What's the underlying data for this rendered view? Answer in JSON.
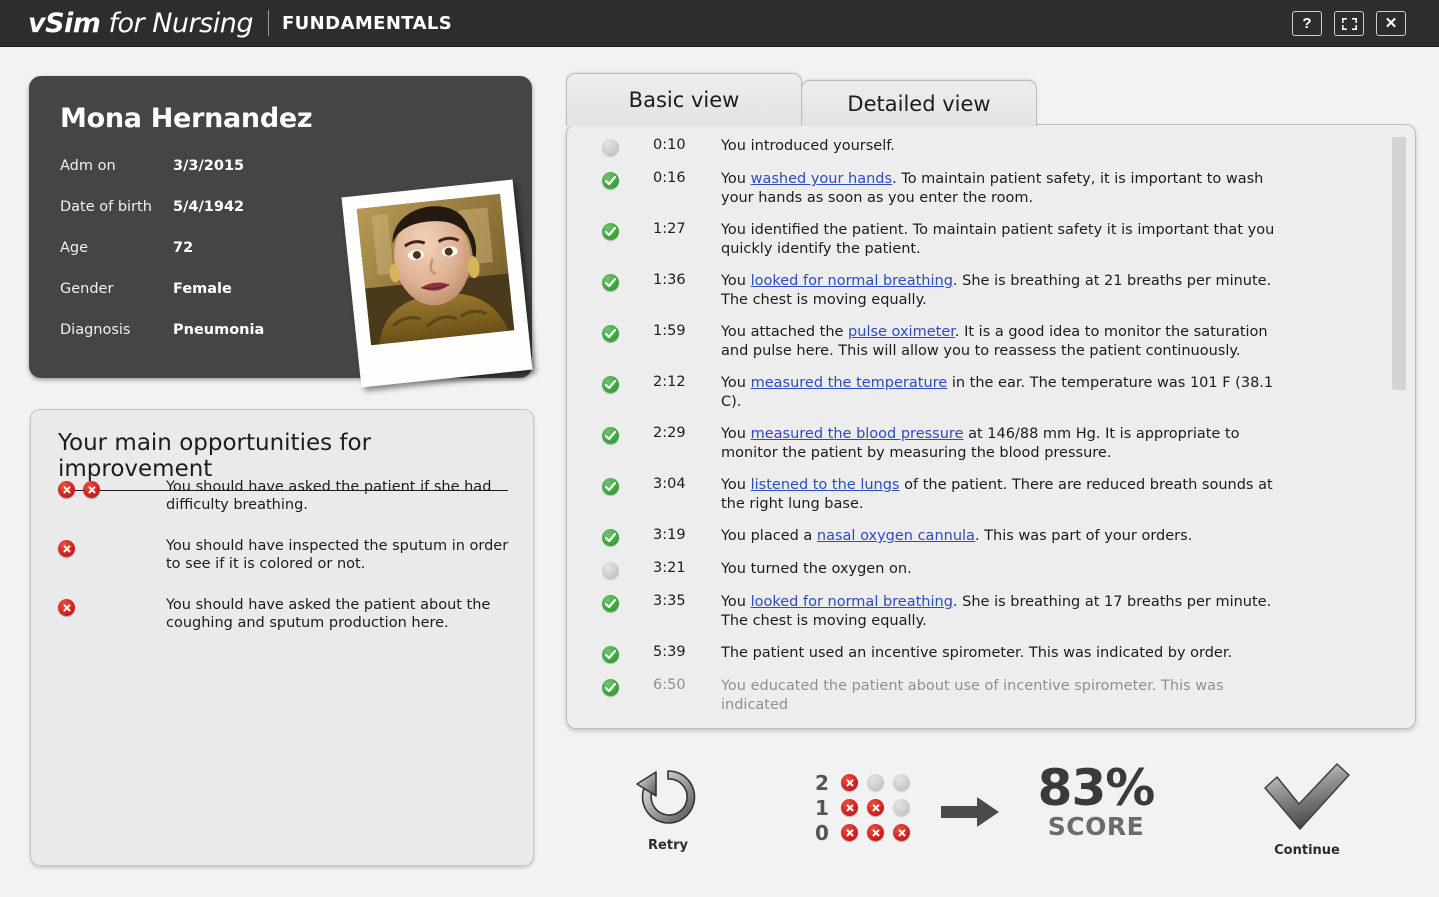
{
  "app": {
    "logo_primary": "vSim for Nursing",
    "logo_primary_bold": "vSim",
    "logo_primary_rest": " for Nursing",
    "logo_secondary": "FUNDAMENTALS"
  },
  "window_controls": {
    "help_label": "?",
    "fullscreen_label": "fullscreen-icon",
    "close_label": "✕"
  },
  "patient": {
    "name": "Mona Hernandez",
    "fields": [
      {
        "label": "Adm on",
        "value": "3/3/2015"
      },
      {
        "label": "Date of birth",
        "value": "5/4/1942"
      },
      {
        "label": "Age",
        "value": "72"
      },
      {
        "label": "Gender",
        "value": "Female"
      },
      {
        "label": "Diagnosis",
        "value": "Pneumonia"
      }
    ]
  },
  "improvements": {
    "title": "Your main opportunities for improvement",
    "items": [
      {
        "icons": 2,
        "text": "You should have asked the patient if she had difficulty breathing."
      },
      {
        "icons": 1,
        "text": "You should have inspected the sputum in order to see if it is colored or not."
      },
      {
        "icons": 1,
        "text": "You should have asked the patient about the coughing and sputum production here."
      }
    ]
  },
  "tabs": [
    {
      "label": "Basic view",
      "active": true
    },
    {
      "label": "Detailed view",
      "active": false
    }
  ],
  "log": {
    "entries": [
      {
        "status": "neutral",
        "time": "0:10",
        "parts": [
          {
            "t": "You introduced yourself."
          }
        ]
      },
      {
        "status": "ok",
        "time": "0:16",
        "parts": [
          {
            "t": "You "
          },
          {
            "t": "washed your hands",
            "link": true
          },
          {
            "t": ". To maintain patient safety, it is important to wash your hands as soon as you enter the room."
          }
        ]
      },
      {
        "status": "ok",
        "time": "1:27",
        "parts": [
          {
            "t": "You identified the patient. To maintain patient safety it is important that you quickly identify the patient."
          }
        ]
      },
      {
        "status": "ok",
        "time": "1:36",
        "parts": [
          {
            "t": "You "
          },
          {
            "t": "looked for normal breathing",
            "link": true
          },
          {
            "t": ". She is breathing at 21 breaths per minute. The chest is moving equally."
          }
        ]
      },
      {
        "status": "ok",
        "time": "1:59",
        "parts": [
          {
            "t": "You attached the "
          },
          {
            "t": "pulse oximeter",
            "link": true
          },
          {
            "t": ". It is a good idea to monitor the saturation and pulse here. This will allow you to reassess the patient continuously."
          }
        ]
      },
      {
        "status": "ok",
        "time": "2:12",
        "parts": [
          {
            "t": "You "
          },
          {
            "t": "measured the temperature",
            "link": true
          },
          {
            "t": " in the ear. The temperature was 101 F (38.1 C)."
          }
        ]
      },
      {
        "status": "ok",
        "time": "2:29",
        "parts": [
          {
            "t": "You "
          },
          {
            "t": "measured the blood pressure",
            "link": true
          },
          {
            "t": " at 146/88 mm Hg. It is appropriate to monitor the patient by measuring the blood pressure."
          }
        ]
      },
      {
        "status": "ok",
        "time": "3:04",
        "parts": [
          {
            "t": "You "
          },
          {
            "t": "listened to the lungs",
            "link": true
          },
          {
            "t": " of the patient. There are reduced breath sounds at the right lung base."
          }
        ]
      },
      {
        "status": "ok",
        "time": "3:19",
        "parts": [
          {
            "t": "You placed a "
          },
          {
            "t": "nasal oxygen cannula",
            "link": true
          },
          {
            "t": ". This was part of your orders."
          }
        ]
      },
      {
        "status": "neutral",
        "time": "3:21",
        "parts": [
          {
            "t": "You turned the oxygen on."
          }
        ]
      },
      {
        "status": "ok",
        "time": "3:35",
        "parts": [
          {
            "t": "You "
          },
          {
            "t": "looked for normal breathing",
            "link": true
          },
          {
            "t": ". She is breathing at 17 breaths per minute. The chest is moving equally."
          }
        ]
      },
      {
        "status": "ok",
        "time": "5:39",
        "parts": [
          {
            "t": "The patient used an incentive spirometer. This was indicated by order."
          }
        ]
      },
      {
        "status": "ok",
        "time": "6:50",
        "parts": [
          {
            "t": "You educated the patient about use of incentive spirometer. This was indicated"
          }
        ]
      }
    ]
  },
  "footer": {
    "retry_label": "Retry",
    "continue_label": "Continue",
    "score_value": "83%",
    "score_label": "SCORE",
    "attempts": [
      {
        "num": "2",
        "cells": [
          "x",
          "gray",
          "gray"
        ]
      },
      {
        "num": "1",
        "cells": [
          "x",
          "x",
          "gray"
        ]
      },
      {
        "num": "0",
        "cells": [
          "x",
          "x",
          "x"
        ]
      }
    ]
  },
  "colors": {
    "header_bg": "#2d2d2d",
    "card_bg": "#454545",
    "panel_bg": "#ededed",
    "link": "#2e4bbf",
    "ok_green": "#3aa63a",
    "error_red": "#cf2020"
  }
}
